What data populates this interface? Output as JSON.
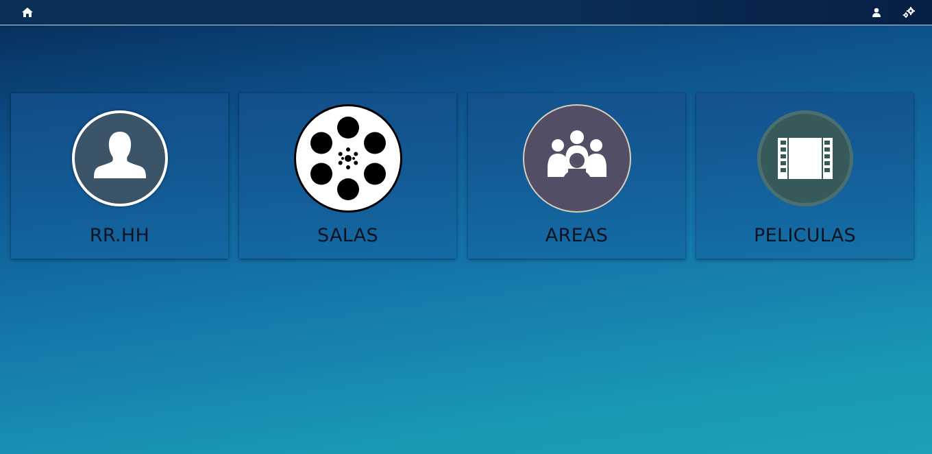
{
  "topbar": {
    "icons": {
      "home": "home-icon",
      "user": "user-icon",
      "settings": "gears-icon"
    }
  },
  "tiles": [
    {
      "label": "RR.HH",
      "icon": "user-silhouette-icon",
      "circle_color": "#3c5468"
    },
    {
      "label": "SALAS",
      "icon": "film-reel-icon",
      "circle_color": "#ffffff"
    },
    {
      "label": "AREAS",
      "icon": "group-people-icon",
      "circle_color": "#544d66"
    },
    {
      "label": "PELICULAS",
      "icon": "film-strip-icon",
      "circle_color": "#355a59"
    }
  ],
  "colors": {
    "accent_topbar": "#0b3055",
    "background_top": "#062a56",
    "background_bottom": "#1ba2b6"
  }
}
